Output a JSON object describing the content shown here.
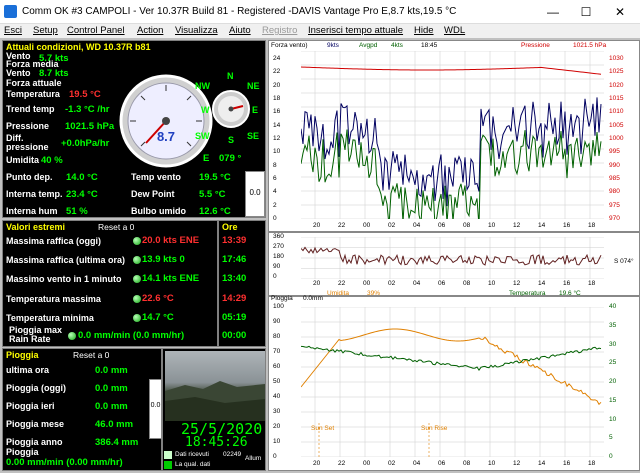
{
  "window": {
    "title": "Comm OK  #3 CAMPOLI - Ver 10.37R Build 81 - Registered  -DAVIS Vantage Pro   E,8.7 kts,19.5 °C",
    "min": "—",
    "max": "☐",
    "close": "✕"
  },
  "menu": [
    "Esci",
    "Setup",
    "Control Panel",
    "Action",
    "Visualizza",
    "Aiuto",
    "Registro",
    "Inserisci tempo attuale",
    "Hide",
    "WDL"
  ],
  "current": {
    "header": "Attuali condizioni, WD 10.37R b81",
    "rows": [
      {
        "label": "Vento",
        "value": "5.7 kts"
      },
      {
        "label": "Forza media\nVento",
        "value": "8.7 kts"
      },
      {
        "label": "Forza attuale",
        "value": ""
      },
      {
        "label": "Temperatura",
        "value": "19.5 °C"
      },
      {
        "label": "Trend temp",
        "value": "-1.3 °C /hr"
      },
      {
        "label": "Pressione",
        "value": "1021.5 hPa"
      },
      {
        "label": "Diff.\npressione",
        "value": "+0.0hPa/hr"
      },
      {
        "label": "Umidita",
        "value": "40 %"
      }
    ],
    "lower": [
      {
        "label": "Punto dep.",
        "value": "14.0 °C",
        "label2": "Temp vento",
        "value2": "19.5 °C"
      },
      {
        "label": "Interna temp.",
        "value": "23.4 °C",
        "label2": "Dew Point",
        "value2": "5.5 °C"
      },
      {
        "label": "Interna hum",
        "value": "51 %",
        "label2": "Bulbo umido",
        "value2": "12.6 °C"
      }
    ],
    "compass_letters": [
      "N",
      "NE",
      "E",
      "SE",
      "S",
      "SW",
      "W",
      "NW"
    ],
    "gauge_speed": "8.7",
    "direction_label": "E",
    "direction_deg": "079 °",
    "side_box": "0.0"
  },
  "extremes": {
    "header": "Valori estremi",
    "reset": "Reset a 0",
    "times_header": "Ore",
    "rows": [
      {
        "label": "Massima raffica (oggi)",
        "value": "20.0 kts ENE",
        "time": "13:39",
        "red": true
      },
      {
        "label": "Massima raffica (ultima ora)",
        "value": "13.9 kts  0",
        "time": "17:46",
        "red": false
      },
      {
        "label": "Massimo vento in 1 minuto",
        "value": "14.1 kts ENE",
        "time": "13:40",
        "red": false
      },
      {
        "label": "Temperatura massima",
        "value": "22.6 °C",
        "time": "14:29",
        "red": true
      },
      {
        "label": "Temperatura minima",
        "value": "14.7 °C",
        "time": "05:19",
        "red": false
      },
      {
        "label": "Pioggia max\nRain Rate",
        "value": "0.0 mm/min (0.0 mm/hr)",
        "time": "00:00",
        "red": false
      }
    ]
  },
  "rain": {
    "header": "Pioggia",
    "reset": "Reset a 0",
    "rows": [
      {
        "label": "ultima ora",
        "value": "0.0 mm"
      },
      {
        "label": "Pioggia (oggi)",
        "value": "0.0 mm"
      },
      {
        "label": "Pioggia ieri",
        "value": "0.0 mm"
      },
      {
        "label": "Pioggia mese",
        "value": "46.0 mm"
      },
      {
        "label": "Pioggia anno",
        "value": "386.4 mm"
      }
    ],
    "rate_label": "Pioggia",
    "rate": "0.00 mm/min (0.00 mm/hr)",
    "side_box": "0.0"
  },
  "webcam": {
    "date": "25/5/2020",
    "time": "18:45:26",
    "received_label": "Dati ricevuti",
    "received_count": "02249",
    "quality_label": "La qual. dati",
    "status": "Allum"
  },
  "graph_wind": {
    "labels": [
      "Forza vento)",
      "9kts",
      "Avgpd",
      "4kts",
      "18:45",
      "Pressione",
      "1021.5 hPa"
    ],
    "y_left": [
      "24",
      "22",
      "20",
      "18",
      "16",
      "14",
      "12",
      "10",
      "8",
      "6",
      "4",
      "2",
      "0"
    ],
    "y_right": [
      "1030",
      "1025",
      "1020",
      "1015",
      "1010",
      "1005",
      "1000",
      "995",
      "990",
      "985",
      "980",
      "975",
      "970"
    ],
    "x_ticks": [
      "20",
      "22",
      "00",
      "02",
      "04",
      "06",
      "08",
      "10",
      "12",
      "14",
      "16",
      "18"
    ]
  },
  "graph_dir": {
    "y_left": [
      "360",
      "270",
      "180",
      "90",
      "0"
    ],
    "right_label": "S 074°",
    "x_ticks": [
      "20",
      "22",
      "00",
      "02",
      "04",
      "06",
      "08",
      "10",
      "12",
      "14",
      "16",
      "18"
    ],
    "labels": [
      "Umidita",
      "39%",
      "Temperatura",
      "19.6 °C"
    ]
  },
  "graph_temp": {
    "labels": [
      "Pioggia",
      "0.0mm"
    ],
    "y_left": [
      "100",
      "90",
      "80",
      "70",
      "60",
      "50",
      "40",
      "30",
      "20",
      "10",
      "0"
    ],
    "y_right": [
      "40",
      "35",
      "30",
      "25",
      "20",
      "15",
      "10",
      "5",
      "0"
    ],
    "x_ticks": [
      "20",
      "22",
      "00",
      "02",
      "04",
      "06",
      "08",
      "10",
      "12",
      "14",
      "16",
      "18"
    ],
    "sunset": "Sun Set",
    "sunrise": "Sun Rise"
  },
  "colors": {
    "wind": "#000060",
    "avg": "#006000",
    "pressure": "#d00000",
    "direction": "#602020",
    "humidity": "#e08000",
    "temperature": "#006000"
  }
}
